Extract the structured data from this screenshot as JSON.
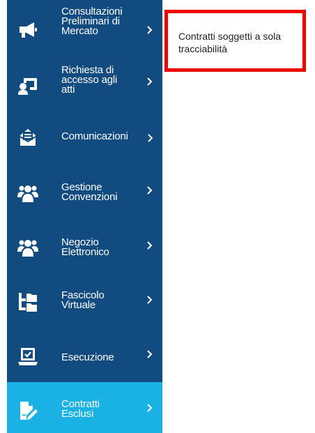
{
  "sidebar": {
    "items": [
      {
        "label_1": "Consultazioni",
        "label_2": "Preliminari di",
        "label_3": "Mercato",
        "icon": "megaphone-icon"
      },
      {
        "label_1": "Richiesta di",
        "label_2": "accesso agli",
        "label_3": "atti",
        "icon": "request-access-icon"
      },
      {
        "label_1": "Comunicazioni",
        "icon": "envelope-icon"
      },
      {
        "label_1": "Gestione",
        "label_2": "Convenzioni",
        "icon": "users-group-icon"
      },
      {
        "label_1": "Negozio",
        "label_2": "Elettronico",
        "icon": "users-group-icon"
      },
      {
        "label_1": "Fascicolo",
        "label_2": "Virtuale",
        "icon": "folder-tree-icon"
      },
      {
        "label_1": "Esecuzione",
        "icon": "laptop-check-icon"
      },
      {
        "label_1": "Contratti",
        "label_2": "Esclusi",
        "icon": "signed-document-icon",
        "active": true
      }
    ]
  },
  "tooltip": {
    "text": "Contratti soggetti a sola tracciabilità"
  },
  "colors": {
    "sidebar_bg": "#124b80",
    "active_bg": "#1ab2e5",
    "highlight_border": "#ee0000"
  }
}
